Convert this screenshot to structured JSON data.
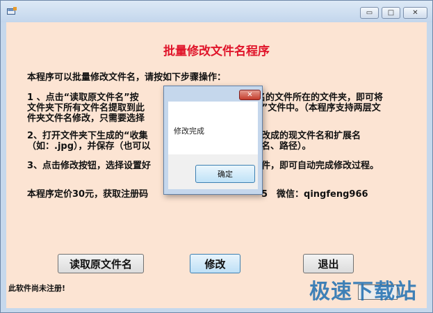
{
  "window": {
    "title": "",
    "minimize_glyph": "▭",
    "maximize_glyph": "□",
    "close_glyph": "✕"
  },
  "main": {
    "heading": "批量修改文件名程序",
    "intro": "本程序可以批量修改文件名，请按如下步骤操作：",
    "step1_line1": "1 、点击“读取原文件名”按",
    "step1_line1_tail": "名的文件所在的文件夹，即可将",
    "step1_line2": "文件夹下所有文件名提取到此",
    "step1_line2_tail": "s”文件中。（本程序支持两层文",
    "step1_line3": "件夹文件名修改，只需要选择",
    "step2_line1": "2、打开文件夹下生成的“收集",
    "step2_line1_tail": "改成的现文件名和扩展名",
    "step2_line2": "（如：.jpg），并保存（也可以",
    "step2_line2_tail": "名、路径）。",
    "step3": "3、点击修改按钮，选择设置好",
    "step3_tail": "件，即可自动完成修改过程。",
    "price": "本程序定价30元，获取注册码",
    "price_tail": "5　微信：qingfeng966"
  },
  "buttons": {
    "read": "读取原文件名",
    "modify": "修改",
    "quit": "退出"
  },
  "status": {
    "unregistered": "此软件尚未注册!"
  },
  "watermark": "极速下载站",
  "dialog": {
    "close_glyph": "✕",
    "message": "修改完成",
    "ok": "确定"
  },
  "colors": {
    "client_bg": "#fce4d3",
    "heading": "#e0142a"
  }
}
